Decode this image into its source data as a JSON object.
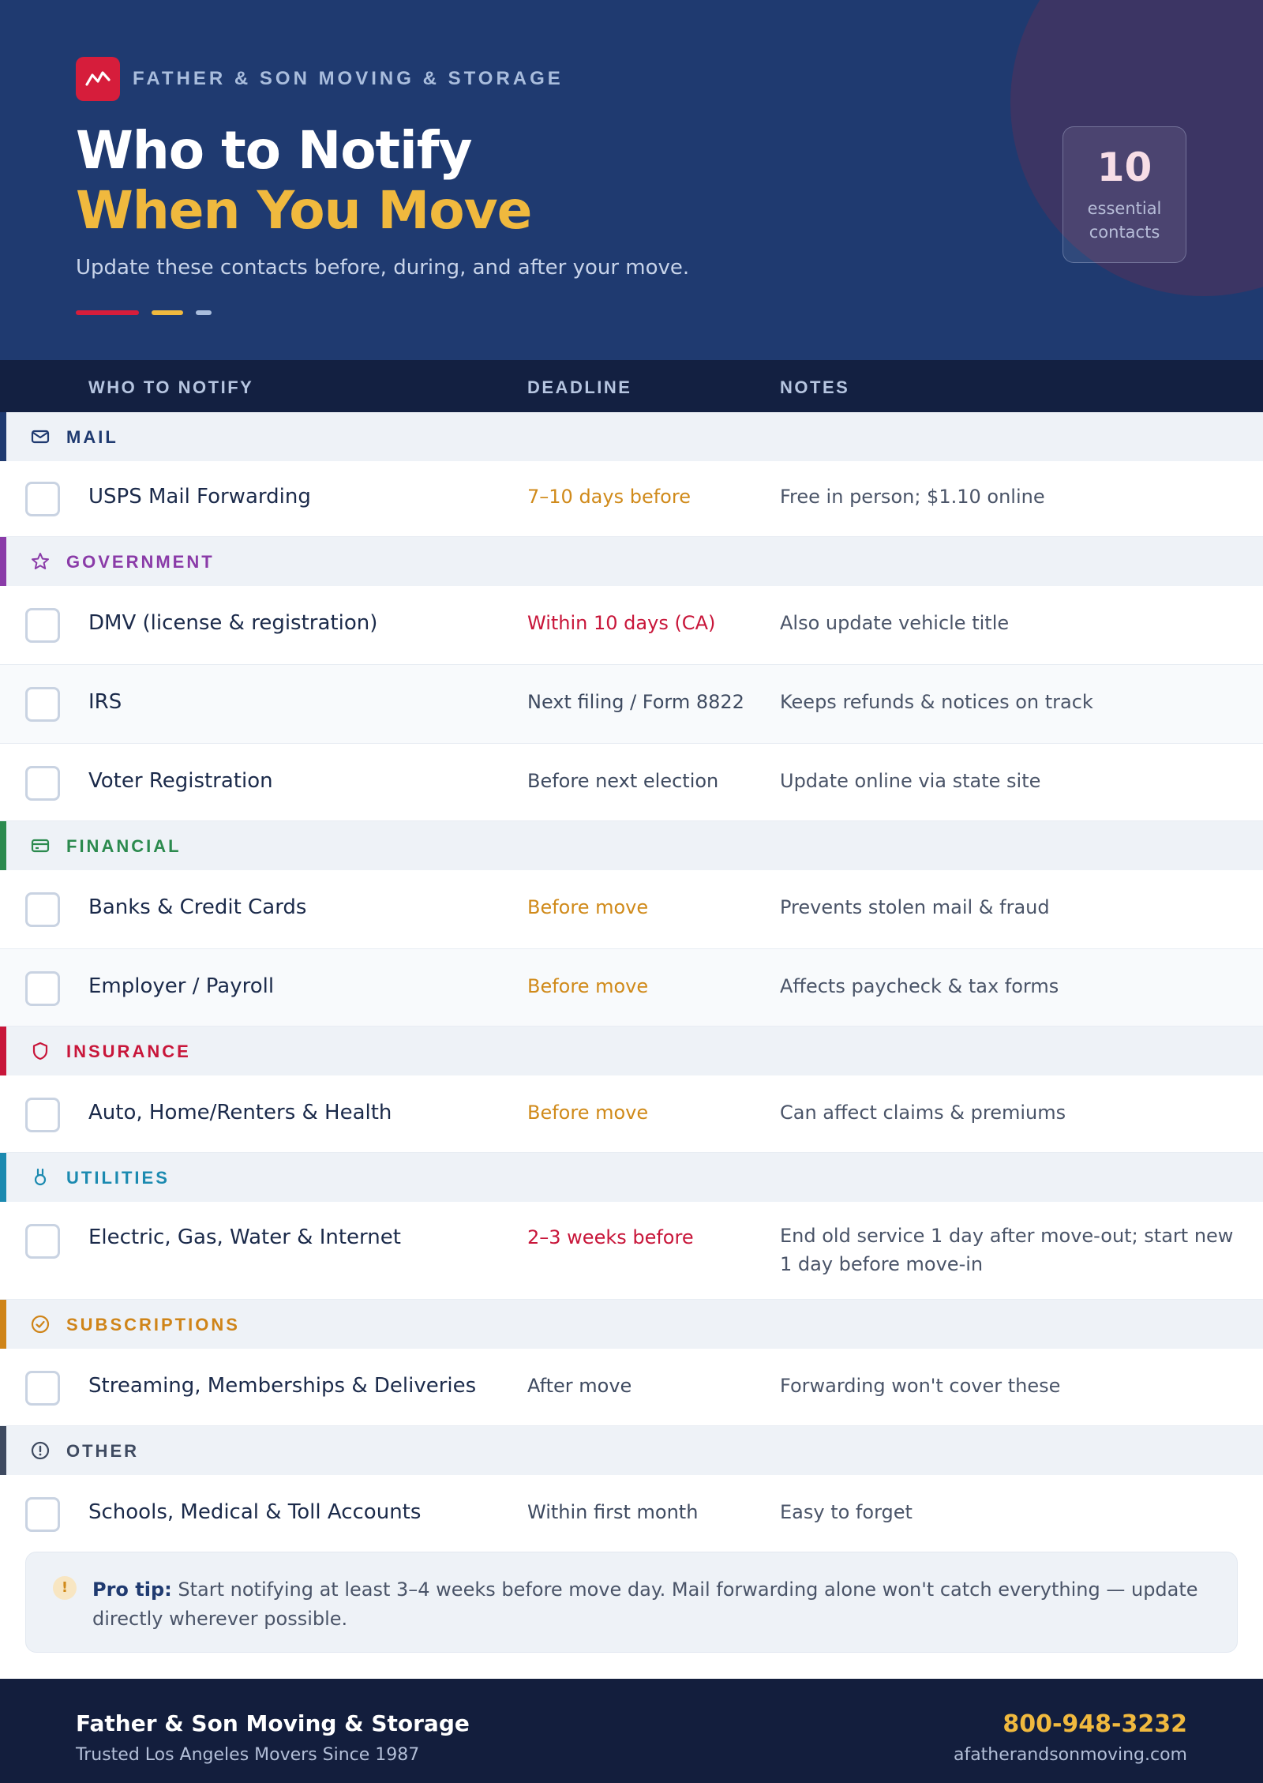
{
  "header": {
    "brand": "FATHER & SON MOVING & STORAGE",
    "title_line1": "Who to Notify",
    "title_line2": "When You Move",
    "subtitle": "Update these contacts before, during, and after your move.",
    "count_value": "10",
    "count_label_line1": "essential",
    "count_label_line2": "contacts"
  },
  "columns": {
    "who": "WHO TO NOTIFY",
    "deadline": "DEADLINE",
    "notes": "NOTES"
  },
  "categories": [
    {
      "label": "MAIL",
      "icon": "mail-icon",
      "color": "#1f3a70",
      "items": [
        {
          "who": "USPS Mail Forwarding",
          "deadline": "7–10 days before",
          "deadline_color": "#d08a1a",
          "notes": "Free in person; $1.10 online"
        }
      ]
    },
    {
      "label": "GOVERNMENT",
      "icon": "star-icon",
      "color": "#8a3ba8",
      "items": [
        {
          "who": "DMV (license & registration)",
          "deadline": "Within 10 days (CA)",
          "deadline_color": "#c8163a",
          "notes": "Also update vehicle title"
        },
        {
          "who": "IRS",
          "deadline": "Next filing / Form 8822",
          "deadline_color": "#3e4a60",
          "notes": "Keeps refunds & notices on track"
        },
        {
          "who": "Voter Registration",
          "deadline": "Before next election",
          "deadline_color": "#3e4a60",
          "notes": "Update online via state site"
        }
      ]
    },
    {
      "label": "FINANCIAL",
      "icon": "credit-card-icon",
      "color": "#2b8a4e",
      "items": [
        {
          "who": "Banks & Credit Cards",
          "deadline": "Before move",
          "deadline_color": "#d08a1a",
          "notes": "Prevents stolen mail & fraud"
        },
        {
          "who": "Employer / Payroll",
          "deadline": "Before move",
          "deadline_color": "#d08a1a",
          "notes": "Affects paycheck & tax forms"
        }
      ]
    },
    {
      "label": "INSURANCE",
      "icon": "shield-icon",
      "color": "#c8163a",
      "items": [
        {
          "who": "Auto, Home/Renters & Health",
          "deadline": "Before move",
          "deadline_color": "#d08a1a",
          "notes": "Can affect claims & premiums"
        }
      ]
    },
    {
      "label": "UTILITIES",
      "icon": "plug-icon",
      "color": "#1b8ab0",
      "items": [
        {
          "who": "Electric, Gas, Water & Internet",
          "deadline": "2–3 weeks before",
          "deadline_color": "#c8163a",
          "notes": "End old service 1 day after move-out; start new 1 day before move-in"
        }
      ]
    },
    {
      "label": "SUBSCRIPTIONS",
      "icon": "check-circle-icon",
      "color": "#cf8418",
      "items": [
        {
          "who": "Streaming, Memberships & Deliveries",
          "deadline": "After move",
          "deadline_color": "#3e4a60",
          "notes": "Forwarding won't cover these"
        }
      ]
    },
    {
      "label": "OTHER",
      "icon": "info-icon",
      "color": "#3e4a60",
      "items": [
        {
          "who": "Schools, Medical & Toll Accounts",
          "deadline": "Within first month",
          "deadline_color": "#3e4a60",
          "notes": "Easy to forget"
        }
      ]
    }
  ],
  "tip": {
    "label": "Pro tip:",
    "text": " Start notifying at least 3–4 weeks before move day. Mail forwarding alone won't catch everything — update directly wherever possible."
  },
  "footer": {
    "company": "Father & Son Moving & Storage",
    "tagline": "Trusted Los Angeles Movers Since 1987",
    "phone": "800-948-3232",
    "website": "afatherandsonmoving.com"
  },
  "colors": {
    "navy": "#1f3a70",
    "accent_red": "#d61d3b",
    "accent_gold": "#f0b93e",
    "accent_light": "#a9bddd"
  }
}
